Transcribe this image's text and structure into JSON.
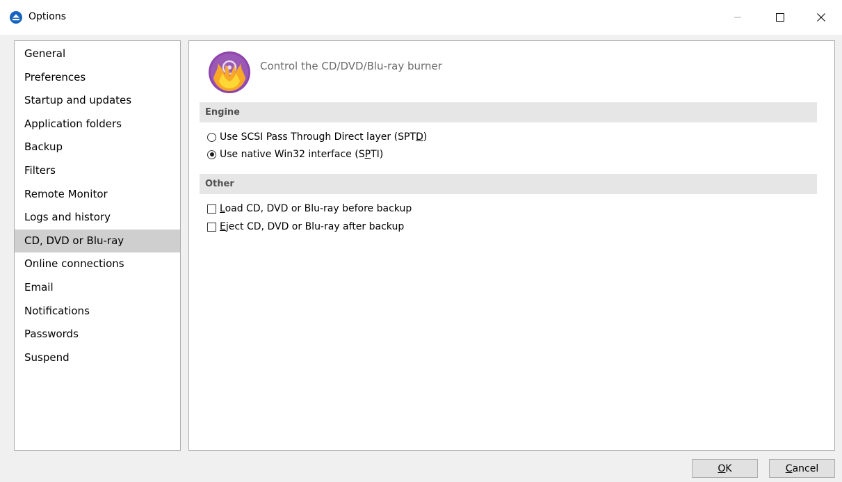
{
  "window": {
    "title": "Options"
  },
  "nav": {
    "items": [
      {
        "label": "General"
      },
      {
        "label": "Preferences"
      },
      {
        "label": "Startup and updates"
      },
      {
        "label": "Application folders"
      },
      {
        "label": "Backup"
      },
      {
        "label": "Filters"
      },
      {
        "label": "Remote Monitor"
      },
      {
        "label": "Logs and history"
      },
      {
        "label": "CD, DVD or Blu-ray"
      },
      {
        "label": "Online connections"
      },
      {
        "label": "Email"
      },
      {
        "label": "Notifications"
      },
      {
        "label": "Passwords"
      },
      {
        "label": "Suspend"
      }
    ],
    "selected_index": 8
  },
  "content": {
    "header_text": "Control the CD/DVD/Blu-ray burner",
    "header_icon": "disc-flame-icon",
    "engine": {
      "title": "Engine",
      "options": [
        {
          "label_before": "Use SCSI Pass Through Direct layer (SPT",
          "mnemonic": "D",
          "label_after": ")",
          "checked": false
        },
        {
          "label_before": "Use native Win32 interface (S",
          "mnemonic": "P",
          "label_after": "TI)",
          "checked": true
        }
      ]
    },
    "other": {
      "title": "Other",
      "options": [
        {
          "mnemonic": "L",
          "label_after": "oad CD, DVD or Blu-ray before backup",
          "checked": false
        },
        {
          "mnemonic": "E",
          "label_after": "ject CD, DVD or Blu-ray after backup",
          "checked": false
        }
      ]
    }
  },
  "buttons": {
    "ok": {
      "mnemonic": "O",
      "rest": "K"
    },
    "cancel": {
      "mnemonic": "C",
      "rest": "ancel"
    }
  },
  "colors": {
    "selected_nav": "#cfcfcf",
    "section_header_bg": "#e6e6e6",
    "app_icon": "#1565c0",
    "disc_icon_bg": "#8e44ad",
    "flame": "#f9a825"
  }
}
